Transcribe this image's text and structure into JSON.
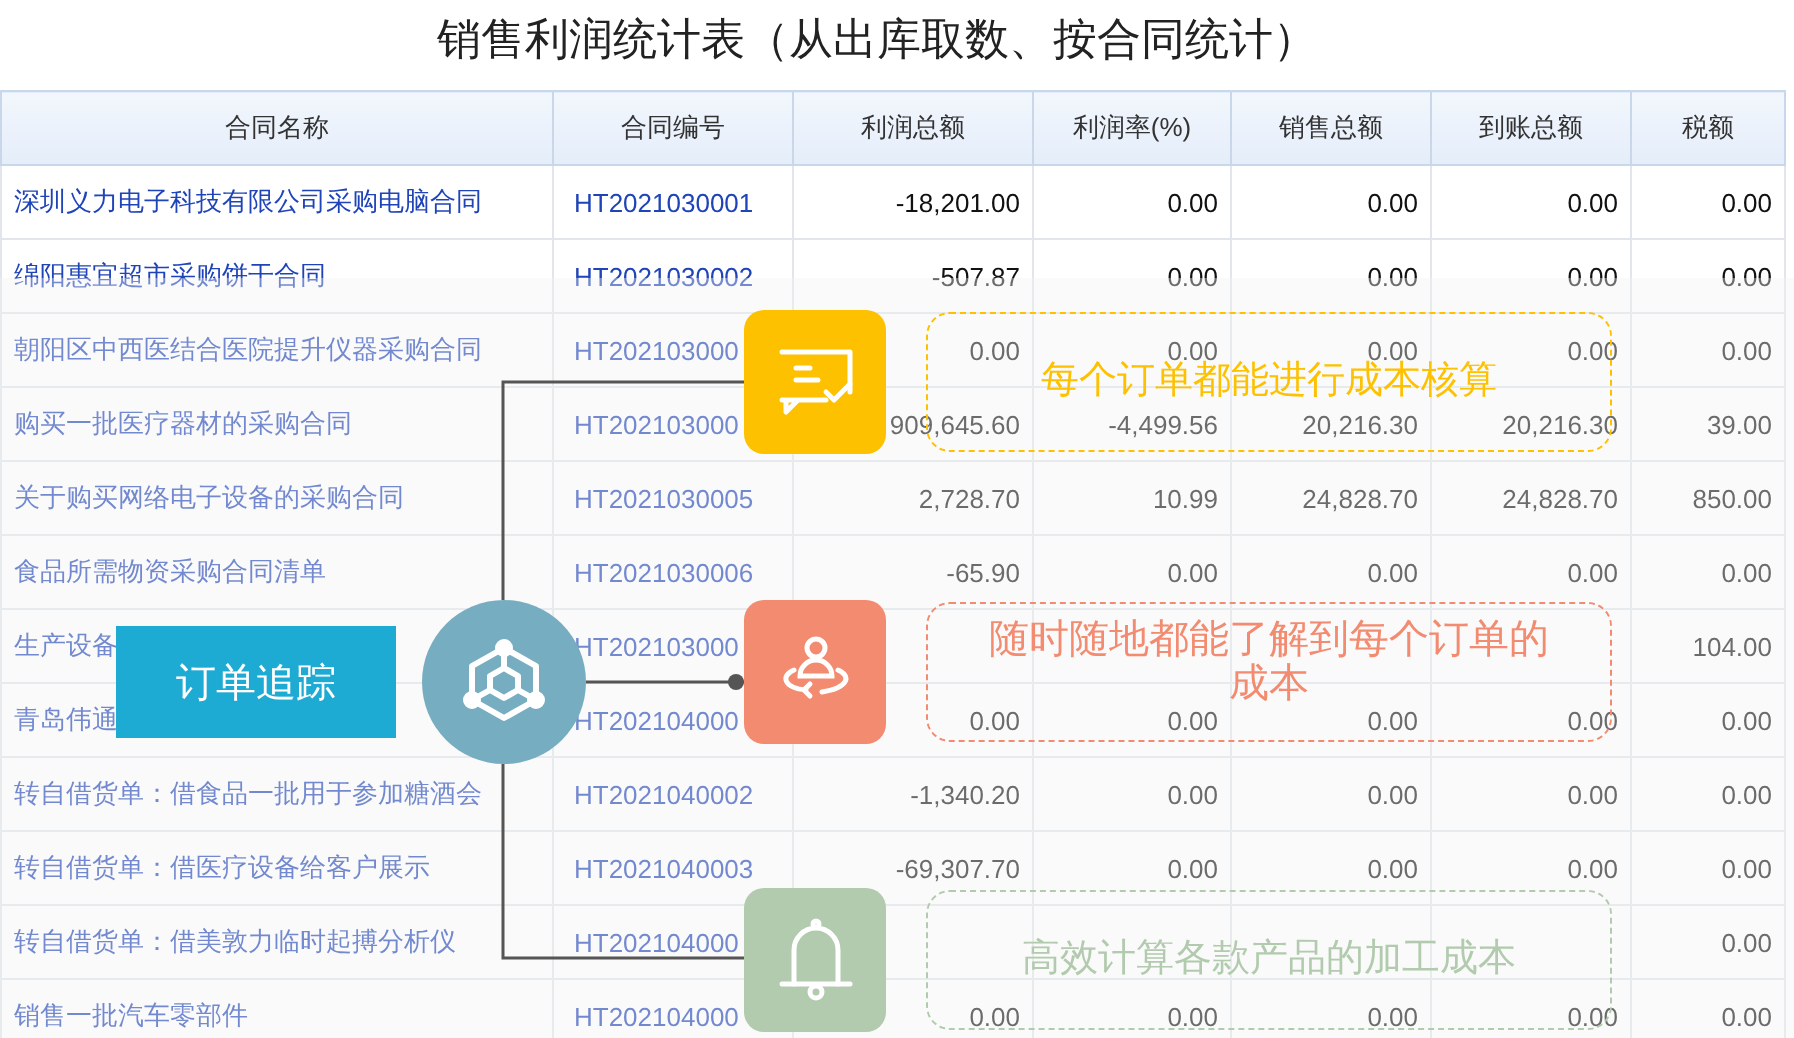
{
  "title": "销售利润统计表（从出库取数、按合同统计）",
  "table": {
    "columns": [
      "合同名称",
      "合同编号",
      "利润总额",
      "利润率(%)",
      "销售总额",
      "到账总额",
      "税额"
    ],
    "rows": [
      {
        "name": "深圳义力电子科技有限公司采购电脑合同",
        "code": "HT2021030001",
        "cells": {
          "profit": "-18,201.00",
          "rate": "0.00",
          "sales": "0.00",
          "received": "0.00",
          "tax": "0.00"
        }
      },
      {
        "name": "绵阳惠宜超市采购饼干合同",
        "code": "HT2021030002",
        "cells": {
          "profit": "-507.87",
          "rate": "0.00",
          "sales": "0.00",
          "received": "0.00",
          "tax": "0.00"
        }
      },
      {
        "name": "朝阳区中西医结合医院提升仪器采购合同",
        "code": "HT202103000",
        "cells": {
          "profit": "0.00",
          "rate": "0.00",
          "sales": "0.00",
          "received": "0.00",
          "tax": "0.00"
        }
      },
      {
        "name": "购买一批医疗器材的采购合同",
        "code": "HT202103000",
        "cells": {
          "profit": "909,645.60",
          "rate": "-4,499.56",
          "sales": "20,216.30",
          "received": "20,216.30",
          "tax": "39.00"
        }
      },
      {
        "name": "关于购买网络电子设备的采购合同",
        "code": "HT2021030005",
        "cells": {
          "profit": "2,728.70",
          "rate": "10.99",
          "sales": "24,828.70",
          "received": "24,828.70",
          "tax": "850.00"
        }
      },
      {
        "name": "食品所需物资采购合同清单",
        "code": "HT2021030006",
        "cells": {
          "profit": "-65.90",
          "rate": "0.00",
          "sales": "0.00",
          "received": "0.00",
          "tax": "0.00"
        }
      },
      {
        "name": "生产设备",
        "code": "HT202103000",
        "cells": {
          "tax": "104.00"
        }
      },
      {
        "name": "青岛伟通",
        "code": "HT202104000",
        "cells": {
          "profit": "0.00",
          "rate": "0.00",
          "sales": "0.00",
          "received": "0.00",
          "tax": "0.00"
        }
      },
      {
        "name": "转自借货单：借食品一批用于参加糖酒会",
        "code": "HT2021040002",
        "cells": {
          "profit": "-1,340.20",
          "rate": "0.00",
          "sales": "0.00",
          "received": "0.00",
          "tax": "0.00"
        }
      },
      {
        "name": "转自借货单：借医疗设备给客户展示",
        "code": "HT2021040003",
        "cells": {
          "profit": "-69,307.70",
          "rate": "0.00",
          "sales": "0.00",
          "received": "0.00",
          "tax": "0.00"
        }
      },
      {
        "name": "转自借货单：借美敦力临时起搏分析仪",
        "code": "HT202104000",
        "cells": {
          "tax": "0.00"
        }
      },
      {
        "name": "销售一批汽车零部件",
        "code": "HT202104000",
        "cells": {
          "profit": "0.00",
          "rate": "0.00",
          "sales": "0.00",
          "received": "0.00",
          "tax": "0.00"
        }
      }
    ]
  },
  "diagram": {
    "center_label": "订单追踪",
    "features": [
      {
        "kind": "chat",
        "color": "#fdc100",
        "text": "每个订单都能进行成本核算"
      },
      {
        "kind": "person",
        "color": "#f28b70",
        "text": "随时随地都能了解到每个订单的成本"
      },
      {
        "kind": "bell",
        "color": "#b2cbae",
        "text": "高效计算各款产品的加工成本"
      }
    ]
  }
}
